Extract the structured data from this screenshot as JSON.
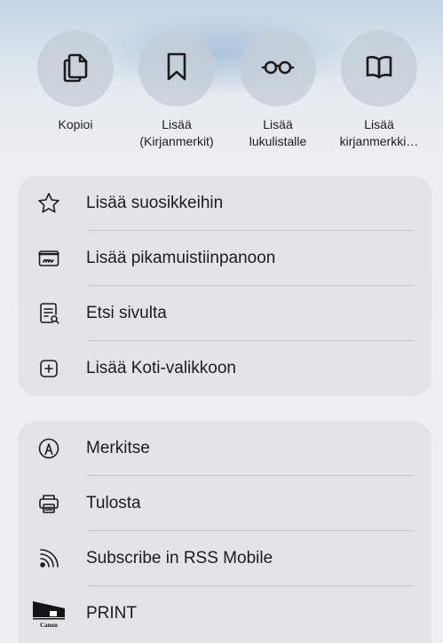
{
  "actions": [
    {
      "label": "Kopioi",
      "icon": "copy-icon"
    },
    {
      "label": "Lisää\n(Kirjanmerkit)",
      "icon": "bookmark-icon"
    },
    {
      "label": "Lisää\nlukulistalle",
      "icon": "glasses-icon"
    },
    {
      "label": "Lisää\nkirjanmerkki…",
      "icon": "book-icon"
    }
  ],
  "group1": [
    {
      "label": "Lisää suosikkeihin",
      "icon": "star-icon"
    },
    {
      "label": "Lisää pikamuistiinpanoon",
      "icon": "quick-note-icon"
    },
    {
      "label": "Etsi sivulta",
      "icon": "find-on-page-icon"
    },
    {
      "label": "Lisää Koti-valikkoon",
      "icon": "add-to-home-icon"
    }
  ],
  "group2": [
    {
      "label": "Merkitse",
      "icon": "markup-icon"
    },
    {
      "label": "Tulosta",
      "icon": "printer-icon"
    },
    {
      "label": "Subscribe in RSS Mobile",
      "icon": "rss-icon"
    },
    {
      "label": "PRINT",
      "icon": "canon-print-icon"
    }
  ]
}
